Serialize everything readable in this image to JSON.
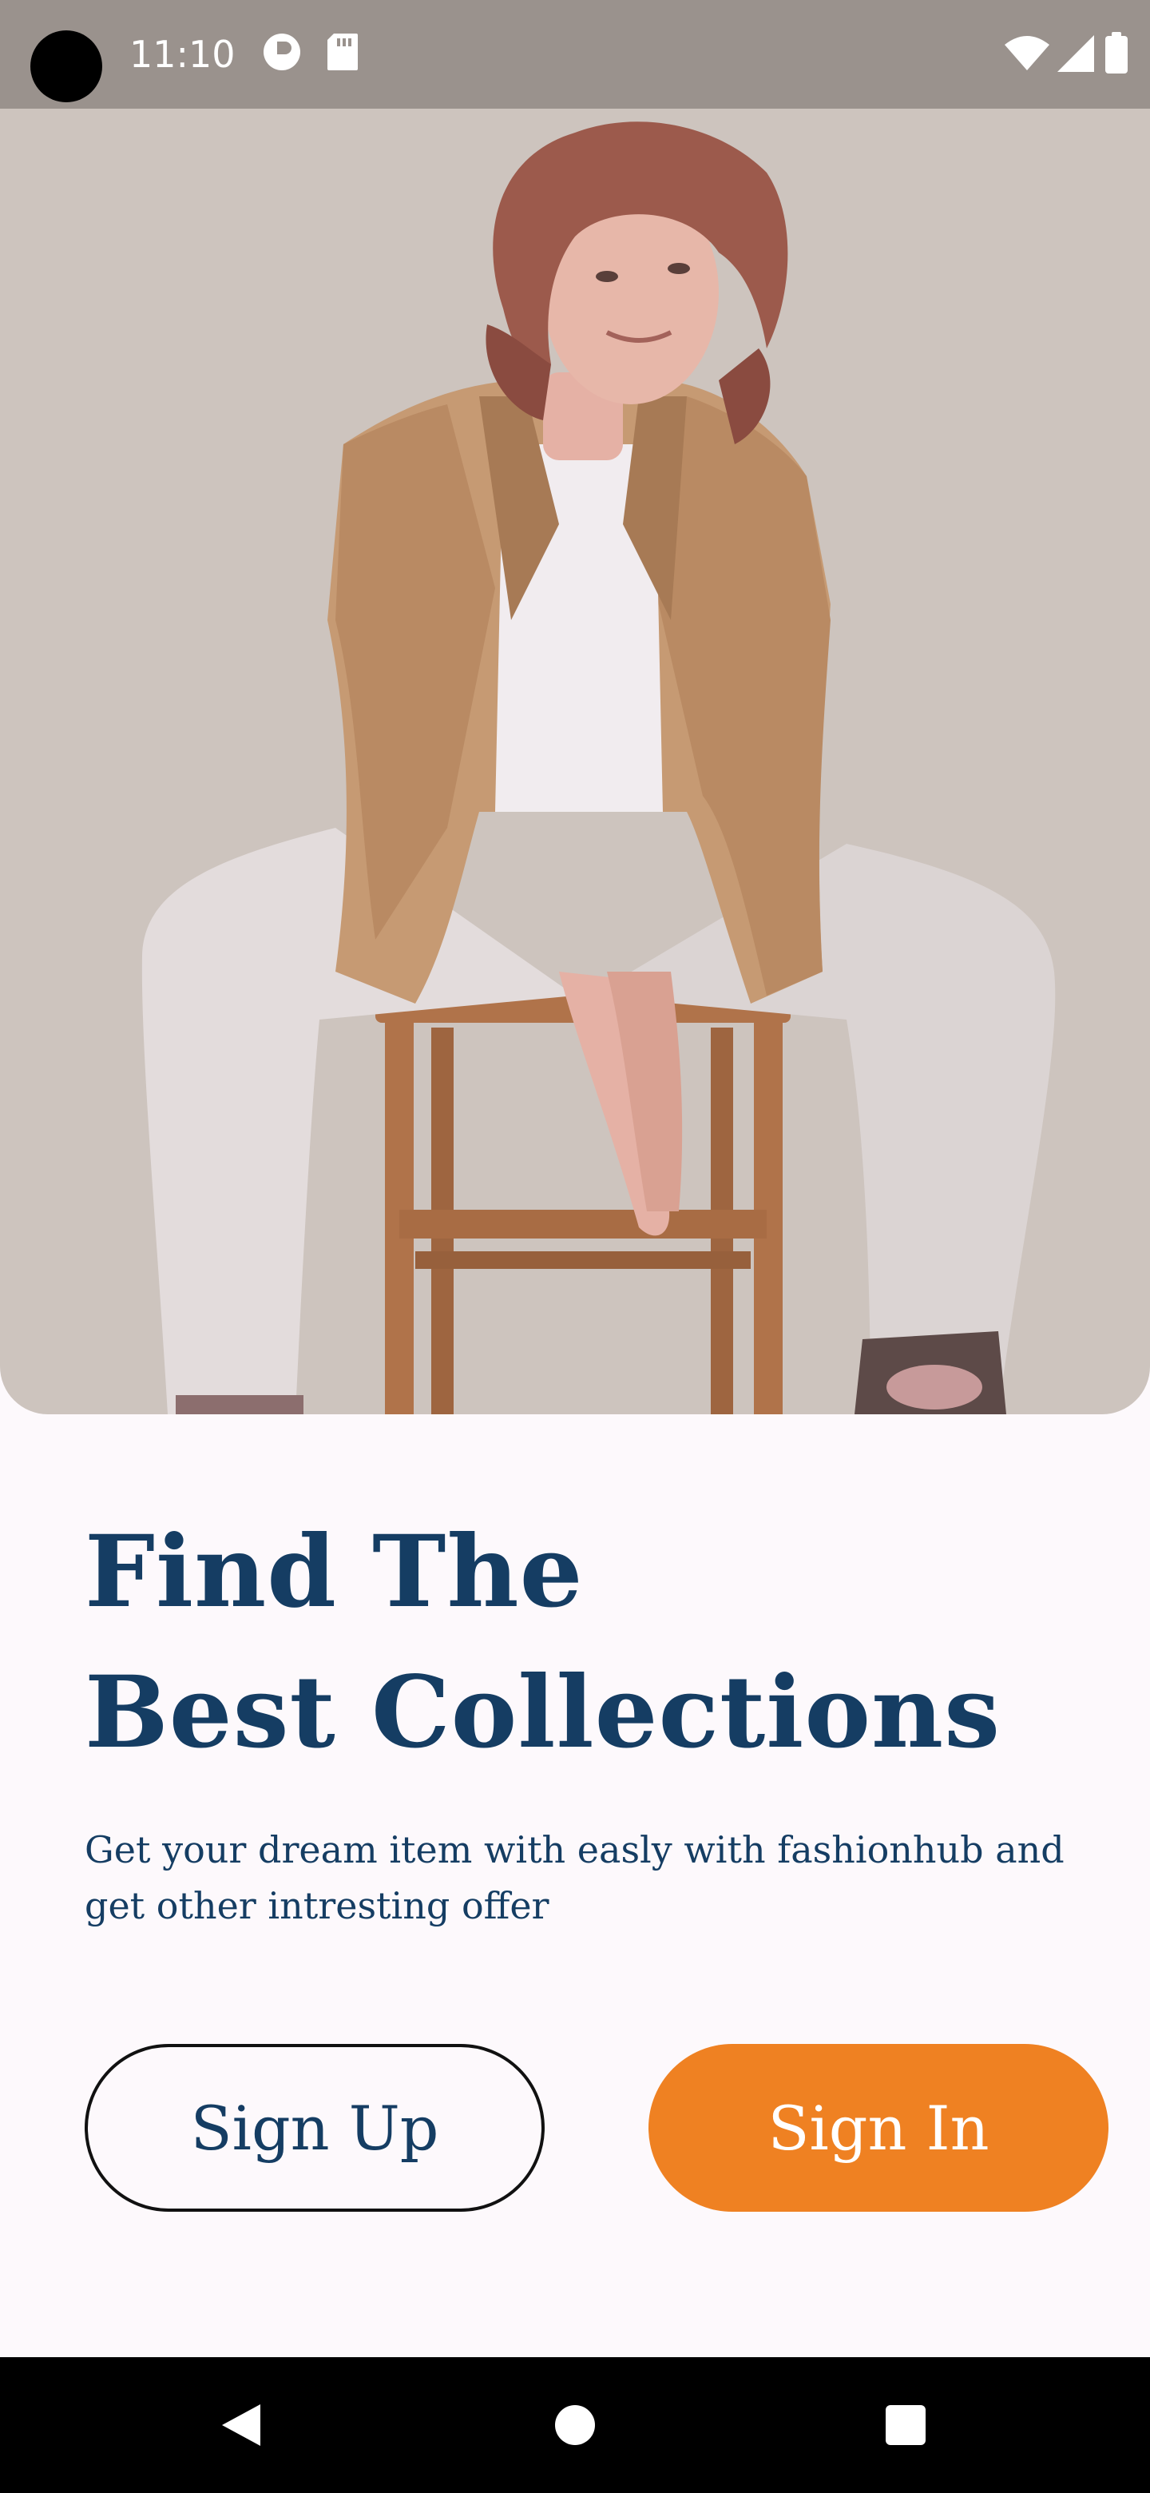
{
  "status_bar": {
    "time": "11:10",
    "icons": [
      "camera-cutout",
      "podcast-app-icon",
      "sd-card-icon",
      "wifi-icon",
      "cellular-signal-icon",
      "battery-icon"
    ]
  },
  "hero": {
    "image": "model-photo",
    "background": "#cdc4be"
  },
  "content": {
    "headline_line1": "Find The",
    "headline_line2": "Best Collections",
    "subtext": "Get your dream item with easly with fashionhub and get other intresting offer"
  },
  "buttons": {
    "sign_up": "Sign Up",
    "sign_in": "Sign In"
  },
  "nav_bar": {
    "icons": [
      "back-icon",
      "home-icon",
      "recents-icon"
    ]
  },
  "colors": {
    "primary": "#153d63",
    "accent": "#ef8122",
    "background": "#fdf9fc",
    "status_bar": "#9a928d"
  }
}
